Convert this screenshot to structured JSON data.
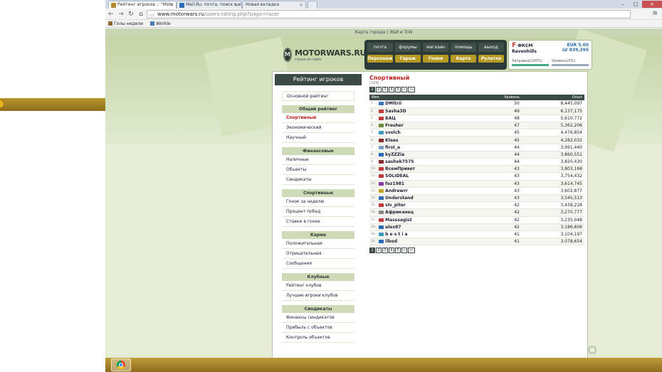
{
  "browser": {
    "tabs": [
      {
        "title": "Рейтинг игроков :: \"Moto"
      },
      {
        "title": "Mail.Ru: почта, поиск в и"
      },
      {
        "title": "Новая вкладка"
      }
    ],
    "url_host": "www.motorwars.ru",
    "url_path": "/users-rating.php?page=racer",
    "bookmarks": [
      {
        "label": "Голы недели"
      },
      {
        "label": "Workle"
      }
    ]
  },
  "site": {
    "topline": "Карта города | ЭБИ и TcW",
    "logo_text": "MOTORWARS.RU",
    "logo_sub": "гонки он-лайн",
    "nav_top": [
      "почта",
      "форумы",
      "магазин",
      "помощь",
      "выход"
    ],
    "nav_bottom": [
      "Персонаж",
      "Гараж",
      "Гонки",
      "Карта",
      "Рулетка"
    ],
    "user": {
      "flag": "F",
      "club": "ФКСМ",
      "name": "Ravenhills",
      "eur": "EUR 5.00",
      "lv": "LV 839,395",
      "fuel_label": "Заправка(100%)",
      "level_label": "Уровень(0%)",
      "fuel_pct": 1.0,
      "level_pct": 0.0
    }
  },
  "sidebar": {
    "title": "Рейтинг игроков",
    "main_item": "Основной рейтинг",
    "groups": [
      {
        "header": "Общий рейтинг",
        "items": [
          "Спортивный",
          "Экономический",
          "Научный"
        ],
        "selected": 0
      },
      {
        "header": "Финансовые",
        "items": [
          "Наличные",
          "Объекты",
          "Синдикаты"
        ],
        "selected": -1
      },
      {
        "header": "Спортивные",
        "items": [
          "Гонок за неделю",
          "Процент побед",
          "Ставки в гонке"
        ],
        "selected": -1
      },
      {
        "header": "Карма",
        "items": [
          "Положительная",
          "Отрицательная",
          "Сообщения"
        ],
        "selected": -1
      },
      {
        "header": "Клубные",
        "items": [
          "Рейтинг клубов",
          "Лучшие игроки клубов"
        ],
        "selected": -1
      },
      {
        "header": "Синдикаты",
        "items": [
          "Финансы синдикатов",
          "Прибыль с объектов",
          "Контроль объектов"
        ],
        "selected": -1
      }
    ]
  },
  "rating": {
    "title": "Спортивный",
    "count": "[324]",
    "pages": [
      "1",
      "2",
      "3",
      "4",
      "5",
      "»",
      "»»"
    ],
    "current_page": "1",
    "columns": {
      "name": "Имя",
      "level": "Уровень",
      "exp": "Опыт"
    },
    "rows": [
      {
        "n": "1.",
        "name": "DMitrii",
        "level": "50",
        "exp": "8,445,097",
        "flag": "#3a78c2"
      },
      {
        "n": "2.",
        "name": "Sasha3D",
        "level": "49",
        "exp": "6,137,175",
        "flag": "#c23a3a"
      },
      {
        "n": "3.",
        "name": "БАЦ",
        "level": "48",
        "exp": "5,610,772",
        "flag": "#c23a3a"
      },
      {
        "n": "4.",
        "name": "Fresher",
        "level": "47",
        "exp": "5,362,206",
        "flag": "#6a8a3a"
      },
      {
        "n": "5.",
        "name": "svolch",
        "level": "45",
        "exp": "4,476,854",
        "flag": "#3a9ac2"
      },
      {
        "n": "6.",
        "name": "Klaas",
        "level": "45",
        "exp": "4,282,032",
        "flag": "#8a2a2a"
      },
      {
        "n": "7.",
        "name": "first_a",
        "level": "44",
        "exp": "3,991,440",
        "flag": "#7aa0c8"
      },
      {
        "n": "8.",
        "name": "kyZZZia",
        "level": "44",
        "exp": "3,860,551",
        "flag": "#2a6ab8"
      },
      {
        "n": "9.",
        "name": "sashok7575",
        "level": "44",
        "exp": "3,820,430",
        "flag": "#8a2a2a"
      },
      {
        "n": "10.",
        "name": "ВсемПривет",
        "level": "43",
        "exp": "3,803,168",
        "flag": "#c23a3a"
      },
      {
        "n": "11.",
        "name": "SOLIDEAL",
        "level": "43",
        "exp": "3,754,432",
        "flag": "#c23a3a"
      },
      {
        "n": "12.",
        "name": "foz1981",
        "level": "43",
        "exp": "3,614,745",
        "flag": "#8a3aa8"
      },
      {
        "n": "13.",
        "name": "Andrewrr",
        "level": "43",
        "exp": "3,602,877",
        "flag": "#c8a020"
      },
      {
        "n": "14.",
        "name": "Understand",
        "level": "43",
        "exp": "3,545,513",
        "flag": "#2a6ab8"
      },
      {
        "n": "15.",
        "name": "slv_piter",
        "level": "42",
        "exp": "3,438,228",
        "flag": "#c23a3a"
      },
      {
        "n": "16.",
        "name": "Африканец",
        "level": "42",
        "exp": "3,270,777",
        "flag": "#888888"
      },
      {
        "n": "17.",
        "name": "Masssagist",
        "level": "42",
        "exp": "3,235,048",
        "flag": "#c23a3a"
      },
      {
        "n": "18.",
        "name": "alex87",
        "level": "42",
        "exp": "3,186,606",
        "flag": "#2a6ab8"
      },
      {
        "n": "19.",
        "name": "b e s t i a",
        "level": "41",
        "exp": "3,104,197",
        "flag": "#3a9ac2"
      },
      {
        "n": "20.",
        "name": "ilbod",
        "level": "41",
        "exp": "3,078,654",
        "flag": "#2a6ab8"
      }
    ]
  }
}
